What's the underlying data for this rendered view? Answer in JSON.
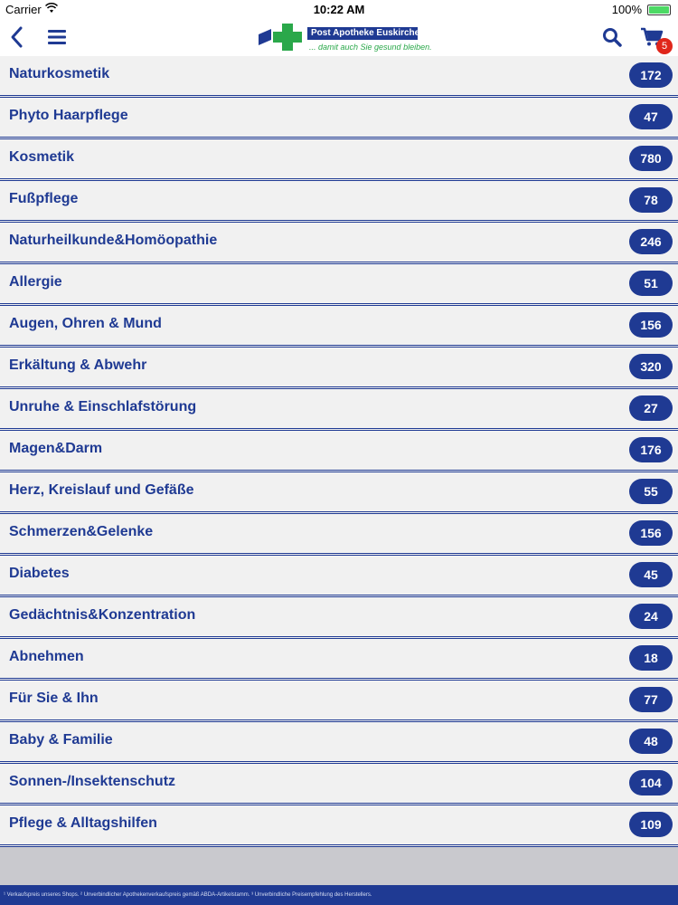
{
  "statusbar": {
    "carrier": "Carrier",
    "time": "10:22 AM",
    "battery": "100%"
  },
  "header": {
    "logo_name": "Post Apotheke Euskirchen",
    "logo_slogan": "... damit auch Sie gesund bleiben.",
    "cart_count": "5",
    "colors": {
      "brand_blue": "#1f3a93",
      "brand_green": "#2aa84a",
      "badge_red": "#e0261b"
    }
  },
  "categories": [
    {
      "label": "Naturkosmetik",
      "count": "172"
    },
    {
      "label": "Phyto Haarpflege",
      "count": "47"
    },
    {
      "label": "Kosmetik",
      "count": "780"
    },
    {
      "label": "Fußpflege",
      "count": "78"
    },
    {
      "label": "Naturheilkunde&Homöopathie",
      "count": "246"
    },
    {
      "label": "Allergie",
      "count": "51"
    },
    {
      "label": "Augen, Ohren & Mund",
      "count": "156"
    },
    {
      "label": "Erkältung & Abwehr",
      "count": "320"
    },
    {
      "label": "Unruhe & Einschlafstörung",
      "count": "27"
    },
    {
      "label": "Magen&Darm",
      "count": "176"
    },
    {
      "label": "Herz, Kreislauf und Gefäße",
      "count": "55"
    },
    {
      "label": "Schmerzen&Gelenke",
      "count": "156"
    },
    {
      "label": "Diabetes",
      "count": "45"
    },
    {
      "label": "Gedächtnis&Konzentration",
      "count": "24"
    },
    {
      "label": "Abnehmen",
      "count": "18"
    },
    {
      "label": "Für Sie & Ihn",
      "count": "77"
    },
    {
      "label": "Baby & Familie",
      "count": "48"
    },
    {
      "label": "Sonnen-/Insektenschutz",
      "count": "104"
    },
    {
      "label": "Pflege & Alltagshilfen",
      "count": "109"
    }
  ],
  "footer": {
    "text": "¹ Verkaufspreis unseres Shops. ² Unverbindlicher Apothekenverkaufspreis gemäß ABDA-Artikelstamm. ³ Unverbindliche Preisempfehlung des Herstellers."
  }
}
